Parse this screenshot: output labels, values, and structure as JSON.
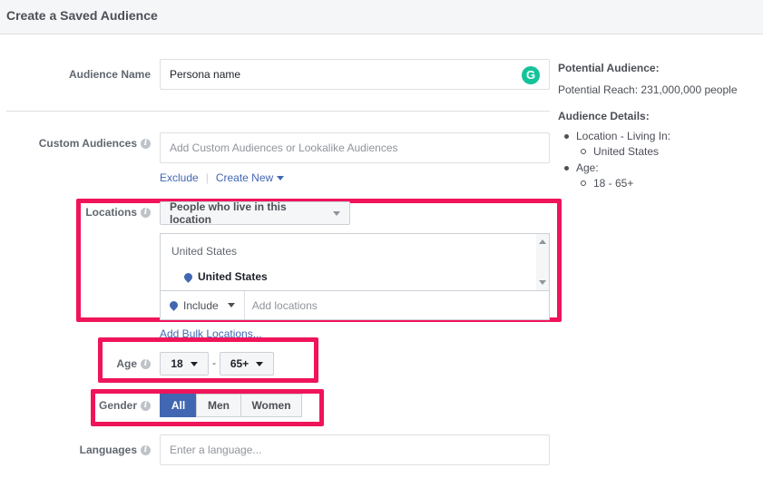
{
  "header": {
    "title": "Create a Saved Audience"
  },
  "audience_name": {
    "label": "Audience Name",
    "value": "Persona name",
    "grammarly_icon": "G"
  },
  "custom_audiences": {
    "label": "Custom Audiences",
    "placeholder": "Add Custom Audiences or Lookalike Audiences",
    "exclude_label": "Exclude",
    "separator": "|",
    "create_new_label": "Create New"
  },
  "locations": {
    "label": "Locations",
    "type_select": "People who live in this location",
    "country_header": "United States",
    "selected_item": "United States",
    "include_label": "Include",
    "add_placeholder": "Add locations",
    "bulk_link": "Add Bulk Locations..."
  },
  "age": {
    "label": "Age",
    "min": "18",
    "separator": "-",
    "max": "65+"
  },
  "gender": {
    "label": "Gender",
    "options": [
      "All",
      "Men",
      "Women"
    ],
    "selected": "All"
  },
  "languages": {
    "label": "Languages",
    "placeholder": "Enter a language..."
  },
  "sidebar": {
    "potential_title": "Potential Audience:",
    "potential_reach": "Potential Reach: 231,000,000 people",
    "details_title": "Audience Details:",
    "details": {
      "location_label": "Location - Living In:",
      "location_value": "United States",
      "age_label": "Age:",
      "age_value": "18 - 65+"
    }
  },
  "colors": {
    "highlight": "#f0145a",
    "accent": "#4267b2",
    "grammarly": "#15c39a"
  },
  "icons": [
    "info-icon",
    "caret-down-icon",
    "location-pin-icon",
    "grammarly-icon",
    "scroll-up-icon",
    "scroll-down-icon"
  ]
}
